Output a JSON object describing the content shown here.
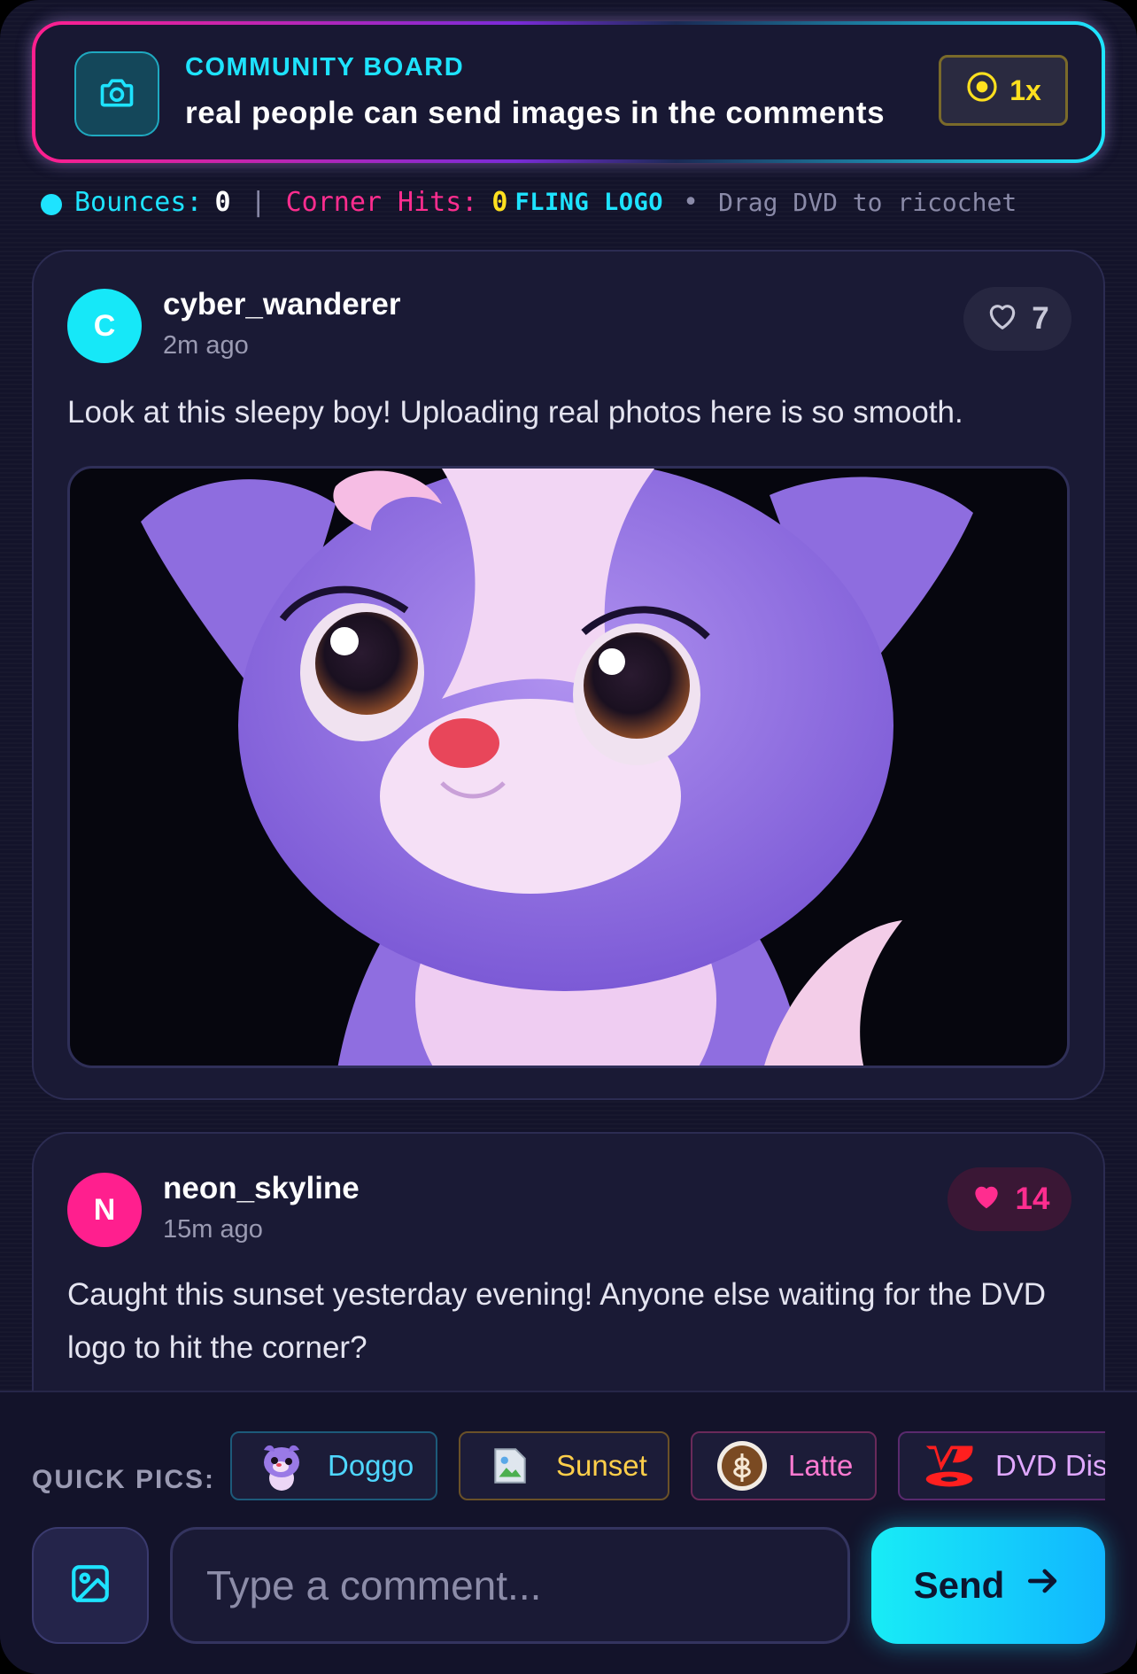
{
  "header": {
    "title": "COMMUNITY BOARD",
    "subtitle": "real people can send images in the comments",
    "speed_label": "1x",
    "camera_icon": "camera-icon",
    "speed_icon": "target-icon"
  },
  "stats": {
    "bounces_label": "Bounces:",
    "bounces_value": "0",
    "separator": "|",
    "corner_label": "Corner Hits:",
    "corner_value": "0",
    "fling_label": "FLING LOGO",
    "bullet": "•",
    "hint": "Drag DVD to ricochet"
  },
  "posts": [
    {
      "avatar_letter": "C",
      "avatar_color": "#16e8f8",
      "username": "cyber_wanderer",
      "time": "2m ago",
      "likes": "7",
      "liked": false,
      "text": "Look at this sleepy boy! Uploading real photos here is so smooth.",
      "image_icon": "cartoon-puppy-image"
    },
    {
      "avatar_letter": "N",
      "avatar_color": "#ff1f8e",
      "username": "neon_skyline",
      "time": "15m ago",
      "likes": "14",
      "liked": true,
      "text": "Caught this sunset yesterday evening! Anyone else waiting for the DVD logo to hit the corner?"
    }
  ],
  "quick_pics": {
    "label": "QUICK PICS:",
    "items": [
      {
        "label": "Doggo",
        "color": "#4fd7ff",
        "icon": "puppy-thumb"
      },
      {
        "label": "Sunset",
        "color": "#ffcf4a",
        "icon": "broken-image-thumb"
      },
      {
        "label": "Latte",
        "color": "#ff7ad1",
        "icon": "latte-thumb"
      },
      {
        "label": "DVD Dis",
        "color": "#e0a8ff",
        "icon": "dvd-logo-thumb"
      }
    ]
  },
  "composer": {
    "placeholder": "Type a comment...",
    "send_label": "Send",
    "image_icon": "image-icon",
    "send_icon": "arrow-right-icon"
  },
  "colors": {
    "cyan": "#1ee3ff",
    "pink": "#ff2d8f",
    "yellow": "#ffe01f",
    "background": "#13132a"
  }
}
